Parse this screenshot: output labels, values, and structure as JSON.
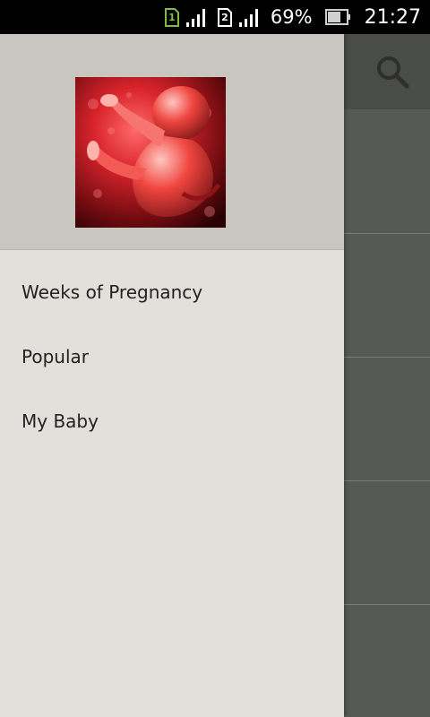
{
  "status_bar": {
    "sim1_label": "1",
    "sim2_label": "2",
    "battery_percent": "69%",
    "time": "21:27",
    "sim1_color": "#7bc043"
  },
  "toolbar": {
    "icon": "search-icon"
  },
  "drawer": {
    "header_image": "fetus-illustration",
    "items": [
      {
        "label": "Weeks of Pregnancy"
      },
      {
        "label": "Popular"
      },
      {
        "label": "My Baby"
      }
    ]
  },
  "colors": {
    "drawer_bg": "#e2e0da",
    "header_bg": "#c9c6c0",
    "scrim": "#575955"
  }
}
